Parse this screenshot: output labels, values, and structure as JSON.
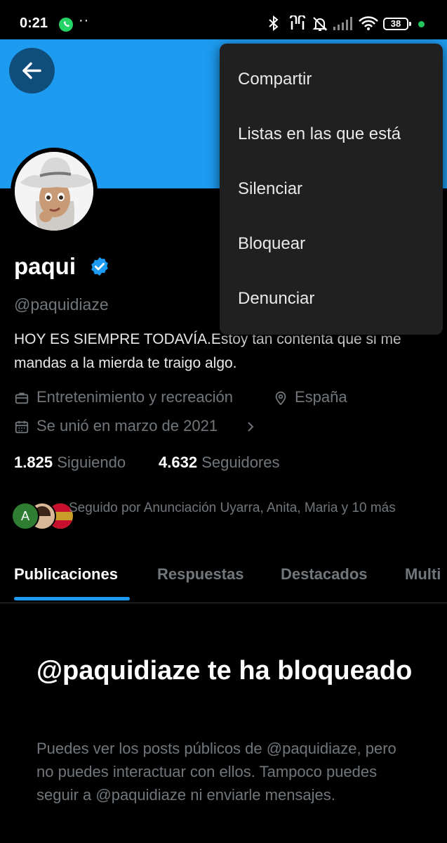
{
  "status_bar": {
    "time": "0:21",
    "dots": "··",
    "battery": "38",
    "icons": [
      "whatsapp-icon",
      "bluetooth-icon",
      "earbuds-icon",
      "bell-muted-icon",
      "signal-icon",
      "wifi-icon",
      "battery-icon"
    ]
  },
  "profile": {
    "name": "paqui",
    "handle": "@paquidiaze",
    "bio": "HOY ES SIEMPRE TODAVÍA.Estoy tan contenta que si me mandas a la mierda te traigo algo.",
    "category": "Entretenimiento y recreación",
    "location": "España",
    "joined": "Se unió en marzo de 2021",
    "following_count": "1.825",
    "following_label": "Siguiendo",
    "followers_count": "4.632",
    "followers_label": "Seguidores",
    "followed_by": "Seguido por Anunciación Uyarra, Anita, Maria y 10 más",
    "follower_avatar_letter": "A"
  },
  "tabs": [
    "Publicaciones",
    "Respuestas",
    "Destacados",
    "Multi"
  ],
  "blocked": {
    "title": "@paquidiaze te ha bloqueado",
    "description": "Puedes ver los posts públicos de @paquidiaze, pero no puedes interactuar con ellos. Tampoco puedes seguir a @paquidiaze ni enviarle mensajes."
  },
  "menu": {
    "items": [
      "Compartir",
      "Listas en las que está",
      "Silenciar",
      "Bloquear",
      "Denunciar"
    ]
  },
  "colors": {
    "accent": "#1d9bf0",
    "background": "#000000",
    "menu_background": "#202020",
    "muted_text": "#71767b"
  }
}
